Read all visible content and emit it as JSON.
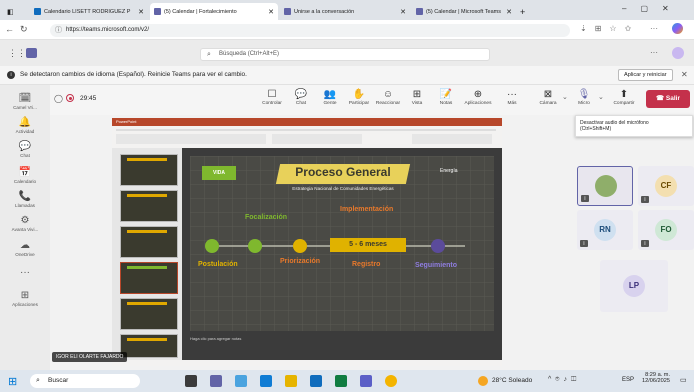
{
  "browser": {
    "tabs": [
      {
        "label": "Calendario LISETT RODRIGUEZ P",
        "color": "#0f6cbd"
      },
      {
        "label": "(5) Calendar | Fortalecimiento",
        "color": "#6264a7"
      },
      {
        "label": "Unirse a la conversación",
        "color": "#6264a7"
      },
      {
        "label": "(5) Calendar | Microsoft Teams",
        "color": "#6264a7"
      }
    ],
    "new_tab": "+",
    "url": "https://teams.microsoft.com/v2/"
  },
  "teams": {
    "search_placeholder": "Búsqueda (Ctrl+Alt+E)",
    "more": "···"
  },
  "banner": {
    "message": "Se detectaron cambios de idioma (Español). Reinicie Teams para ver el cambio.",
    "action": "Aplicar y reiniciar",
    "close": "✕"
  },
  "rail": [
    {
      "icon": "🗓",
      "label": "Camel Vri..."
    },
    {
      "icon": "🔔",
      "label": "Actividad"
    },
    {
      "icon": "💬",
      "label": "Chat"
    },
    {
      "icon": "📅",
      "label": "Calendario"
    },
    {
      "icon": "📞",
      "label": "Llamadas"
    },
    {
      "icon": "⚙",
      "label": "Avanta Vivi..."
    },
    {
      "icon": "☁",
      "label": "OneDrive"
    },
    {
      "icon": "···",
      "label": ""
    },
    {
      "icon": "⊞",
      "label": "Aplicaciones"
    }
  ],
  "meeting": {
    "timer": "29:45",
    "buttons": [
      {
        "icon": "☐",
        "label": "Controlar"
      },
      {
        "icon": "💬",
        "label": "Chat"
      },
      {
        "icon": "👥",
        "label": "Gente"
      },
      {
        "icon": "✋",
        "label": "Participar"
      },
      {
        "icon": "☺",
        "label": "Reaccionar"
      },
      {
        "icon": "⊞",
        "label": "Vista"
      },
      {
        "icon": "📝",
        "label": "Notas"
      },
      {
        "icon": "⊕",
        "label": "Aplicaciones"
      },
      {
        "icon": "···",
        "label": "Más"
      }
    ],
    "camera": "Cámara",
    "mic": "Micro",
    "share": "Compartir",
    "leave": "Salir",
    "tooltip_line1": "Desactivar audio del micrófono",
    "tooltip_line2": "(Ctrl+Shift+M)",
    "presenter_name": "IGOR ELI OLARTE FAJARDO"
  },
  "slide": {
    "title": "Proceso General",
    "subtitle": "Estrategia Nacional de Comunidades Energéticas",
    "logo_left": "VIDA",
    "logo_right": "Energía",
    "stages": [
      {
        "title": "Focalización"
      },
      {
        "title": "Implementación"
      },
      {
        "title": "Postulación"
      },
      {
        "title": "Priorización"
      },
      {
        "title": "Registro"
      },
      {
        "title": "Seguimiento"
      }
    ],
    "duration": "5 - 6 meses",
    "notes": "Haga clic para agregar notas"
  },
  "participants": [
    {
      "initials": "",
      "photo": true,
      "bg": "#dfe6d3"
    },
    {
      "initials": "CF",
      "bg": "#f3dfb0",
      "fg": "#6a4a00"
    },
    {
      "initials": "RN",
      "bg": "#cfe0f0",
      "fg": "#1d4d7a"
    },
    {
      "initials": "FO",
      "bg": "#cfe8d6",
      "fg": "#1f5a35"
    },
    {
      "initials": "LP",
      "bg": "#d8d2ee",
      "fg": "#3b2f7a"
    }
  ],
  "taskbar": {
    "search": "Buscar",
    "weather": "28°C Soleado",
    "lang": "ESP",
    "time": "8:29 a. m.",
    "date": "12/06/2025"
  },
  "colors": {
    "leave_red": "#c4314b",
    "teams_purple": "#6264a7",
    "slide_green": "#7fb82e",
    "slide_gold": "#e0b200",
    "slide_orange": "#e8792b",
    "slide_purple": "#5b4b9b"
  }
}
